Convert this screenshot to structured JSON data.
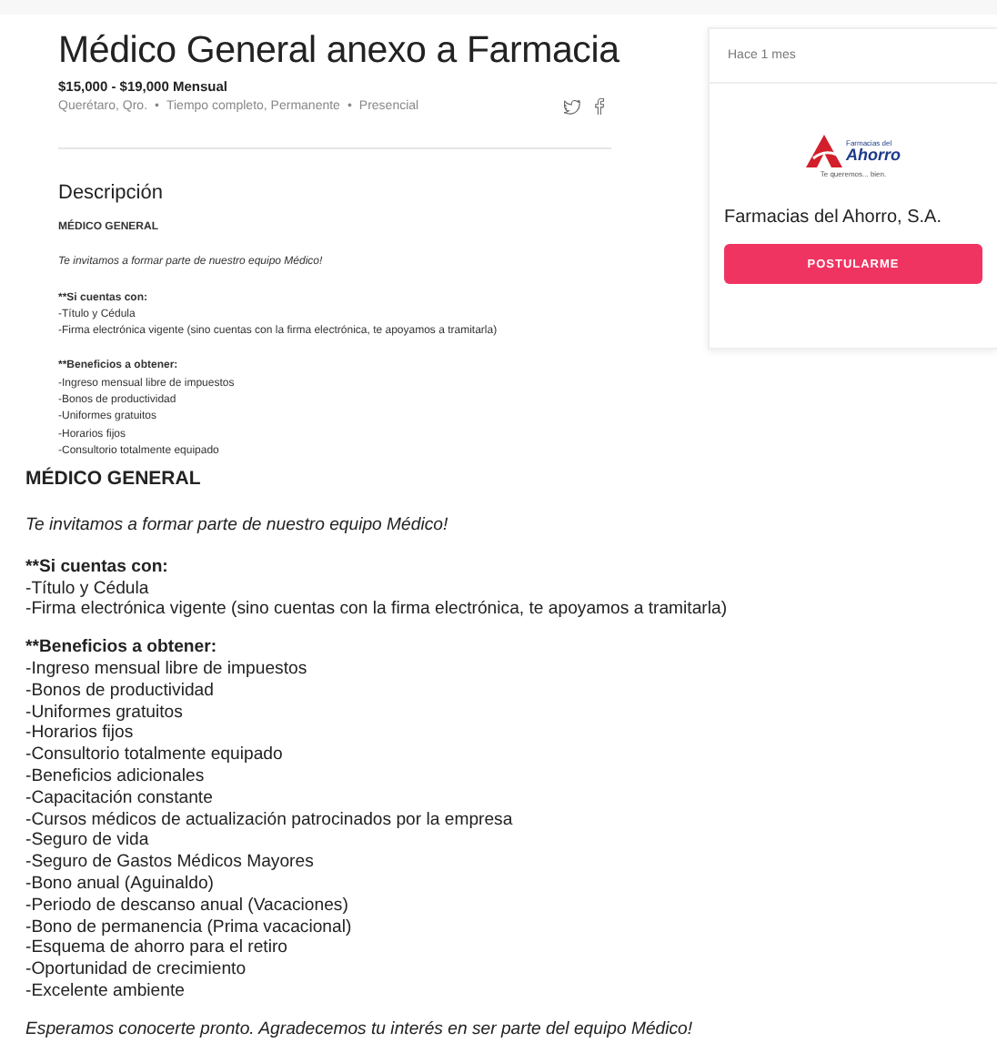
{
  "job": {
    "title": "Médico General anexo a Farmacia",
    "salary": "$15,000 - $19,000 Mensual",
    "meta": [
      "Querétaro, Qro.",
      "Tiempo completo, Permanente",
      "Presencial"
    ],
    "separator": "•"
  },
  "description": {
    "heading": "Descripción",
    "blocks": [
      {
        "kind": "title",
        "text": "MÉDICO GENERAL"
      },
      {
        "kind": "intro",
        "text": "Te invitamos a formar parte de nuestro equipo Médico!"
      },
      {
        "kind": "list",
        "heading": "**Si cuentas con:",
        "items": [
          "-Título y Cédula",
          "-Firma electrónica vigente (sino cuentas con la firma electrónica, te apoyamos a tramitarla)"
        ]
      },
      {
        "kind": "list",
        "heading": "**Beneficios a obtener:",
        "items": [
          "-Ingreso mensual libre de impuestos",
          "-Bonos de productividad",
          "-Uniformes gratuitos",
          "-Horarios fijos",
          "-Consultorio totalmente equipado"
        ]
      }
    ]
  },
  "full_description": {
    "blocks": [
      {
        "kind": "title",
        "text": "MÉDICO GENERAL"
      },
      {
        "kind": "intro",
        "text": "Te invitamos a formar parte de nuestro equipo Médico!"
      },
      {
        "kind": "list",
        "heading": "**Si cuentas con:",
        "items": [
          "-Título y Cédula",
          "-Firma electrónica vigente (sino cuentas con la firma electrónica, te apoyamos a tramitarla)"
        ]
      },
      {
        "kind": "list",
        "heading": "**Beneficios a obtener:",
        "items": [
          "-Ingreso mensual libre de impuestos",
          "-Bonos de productividad",
          "-Uniformes gratuitos",
          "-Horarios fijos",
          "-Consultorio totalmente equipado",
          "-Beneficios adicionales",
          "-Capacitación constante",
          "-Cursos médicos de actualización patrocinados por la empresa",
          "-Seguro de vida",
          "-Seguro de Gastos Médicos Mayores",
          "-Bono anual (Aguinaldo)",
          "-Periodo de descanso anual (Vacaciones)",
          "-Bono de permanencia (Prima vacacional)",
          "-Esquema de ahorro para el retiro",
          "-Oportunidad de crecimiento",
          "-Excelente ambiente"
        ]
      },
      {
        "kind": "outro",
        "text": "Esperamos conocerte pronto. Agradecemos tu interés en ser parte del equipo Médico!"
      }
    ]
  },
  "company_card": {
    "posted": "Hace 1 mes",
    "logo": {
      "line_1": "Farmacias del",
      "line_2": "Ahorro",
      "tagline": "Te queremos... bien."
    },
    "company": "Farmacias del Ahorro, S.A.",
    "button": "POSTULARME"
  }
}
